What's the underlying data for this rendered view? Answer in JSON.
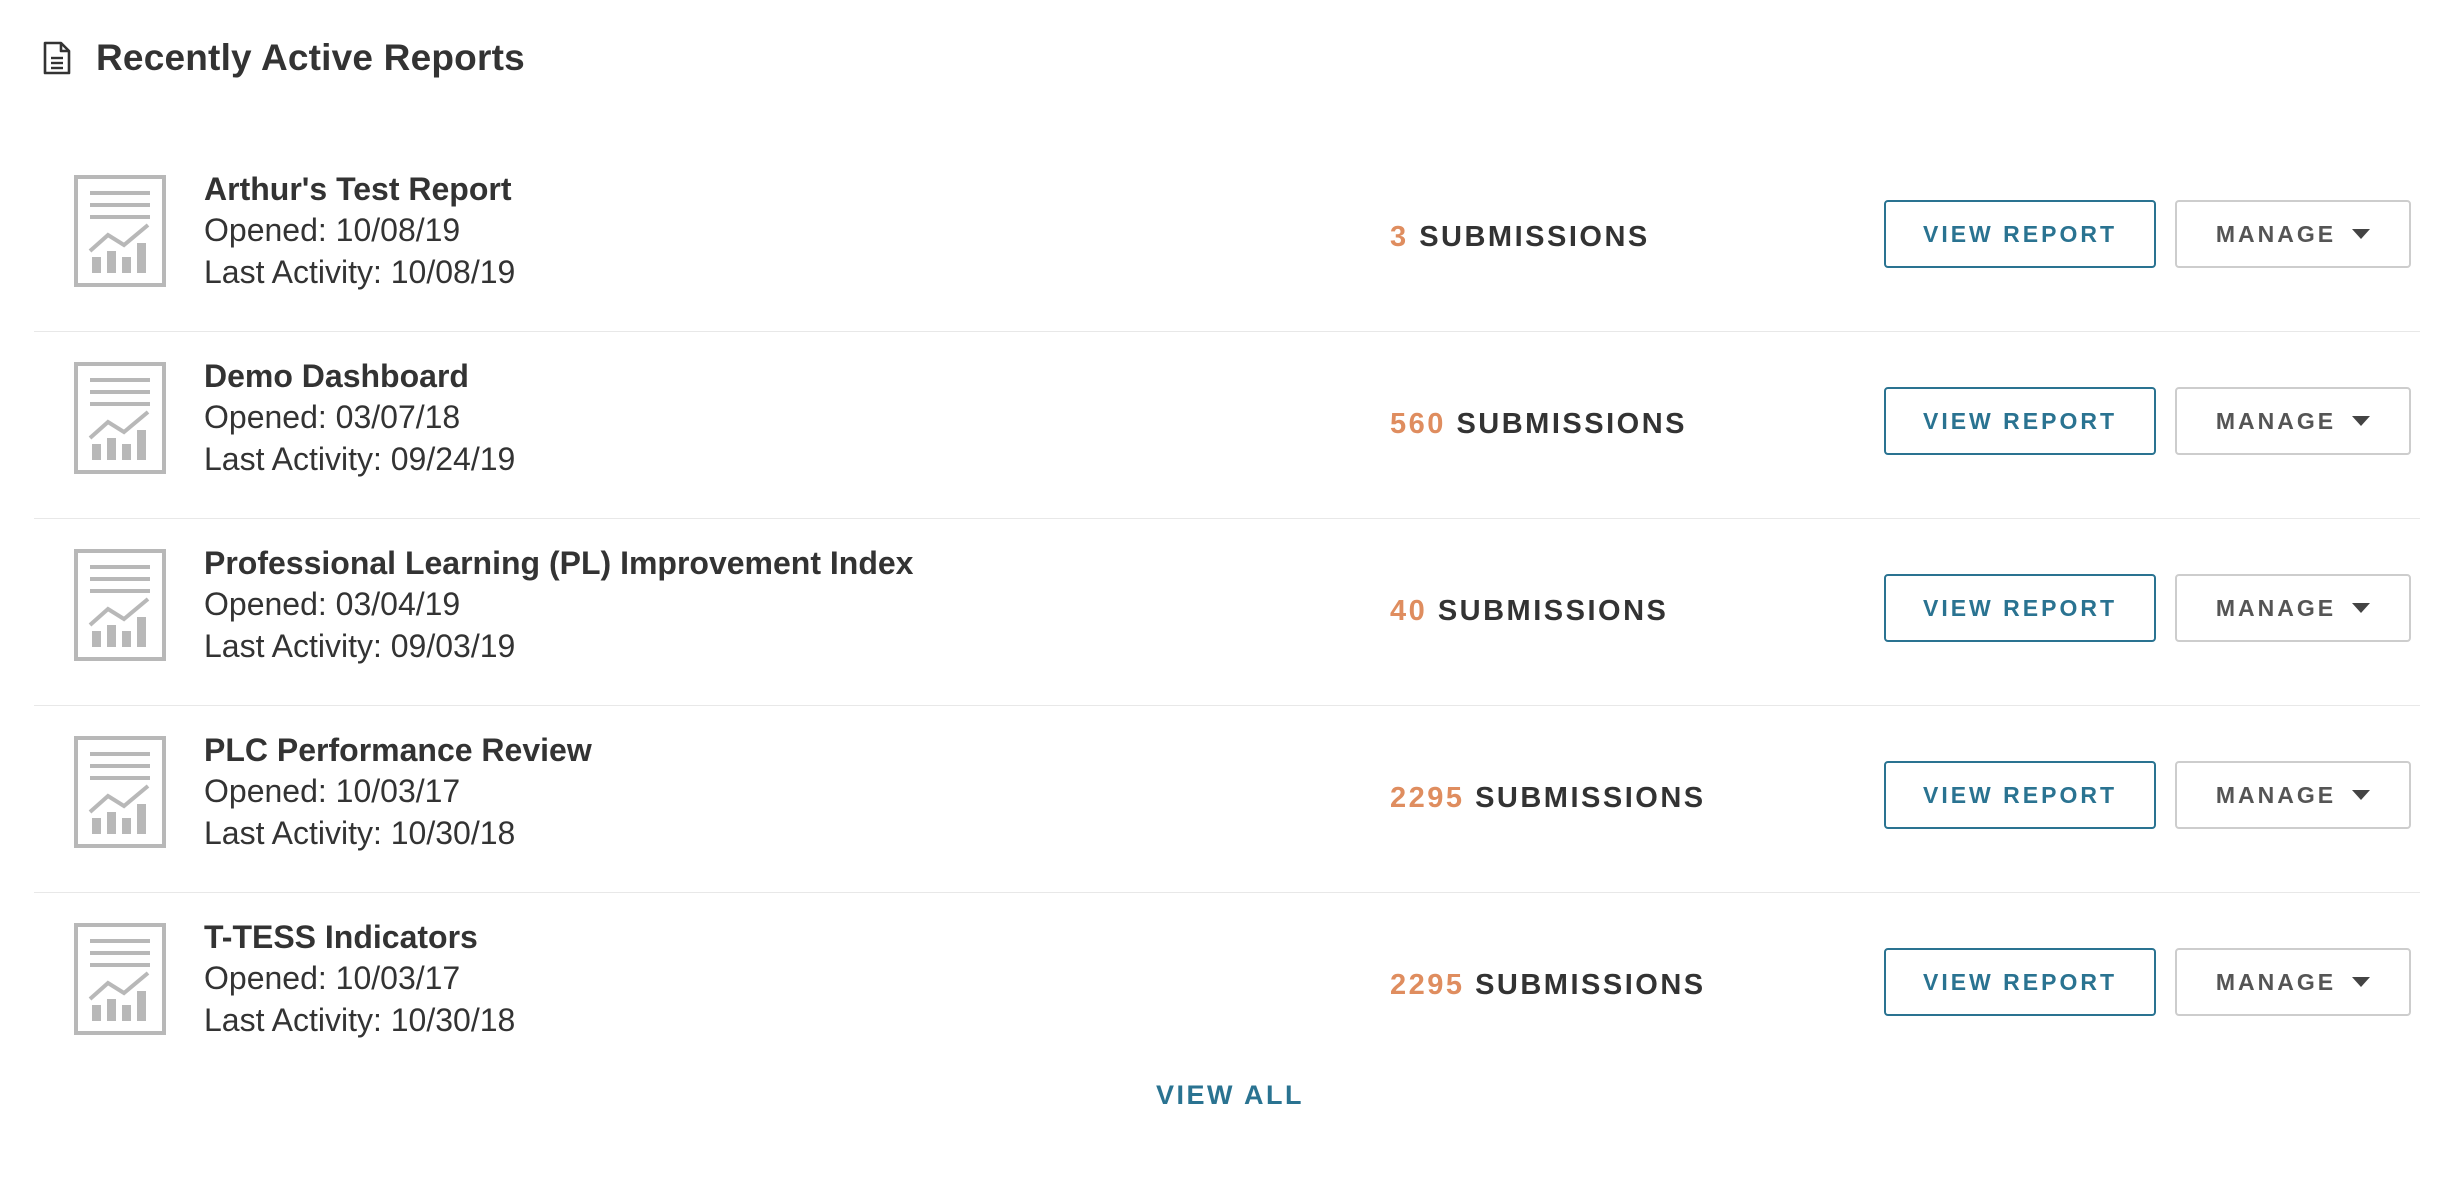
{
  "header": {
    "title": "Recently Active Reports",
    "icon": "document-icon"
  },
  "reports": [
    {
      "title": "Arthur's Test Report",
      "opened": "Opened: 10/08/19",
      "last_activity": "Last Activity: 10/08/19",
      "submissions_count": "3",
      "submissions_label": "SUBMISSIONS",
      "view_label": "VIEW REPORT",
      "manage_label": "MANAGE"
    },
    {
      "title": "Demo Dashboard",
      "opened": "Opened: 03/07/18",
      "last_activity": "Last Activity: 09/24/19",
      "submissions_count": "560",
      "submissions_label": "SUBMISSIONS",
      "view_label": "VIEW REPORT",
      "manage_label": "MANAGE"
    },
    {
      "title": "Professional Learning (PL) Improvement Index",
      "opened": "Opened: 03/04/19",
      "last_activity": "Last Activity: 09/03/19",
      "submissions_count": "40",
      "submissions_label": "SUBMISSIONS",
      "view_label": "VIEW REPORT",
      "manage_label": "MANAGE"
    },
    {
      "title": "PLC Performance Review",
      "opened": "Opened: 10/03/17",
      "last_activity": "Last Activity: 10/30/18",
      "submissions_count": "2295",
      "submissions_label": "SUBMISSIONS",
      "view_label": "VIEW REPORT",
      "manage_label": "MANAGE"
    },
    {
      "title": "T-TESS Indicators",
      "opened": "Opened: 10/03/17",
      "last_activity": "Last Activity: 10/30/18",
      "submissions_count": "2295",
      "submissions_label": "SUBMISSIONS",
      "view_label": "VIEW REPORT",
      "manage_label": "MANAGE"
    }
  ],
  "footer": {
    "view_all_label": "VIEW ALL"
  },
  "colors": {
    "accent": "#2a7391",
    "count": "#df8d5f",
    "text": "#333333",
    "icon_gray": "#b8b8b8"
  },
  "icons": {
    "report_thumbnail": "report-chart-icon",
    "manage_caret": "caret-down-icon"
  }
}
